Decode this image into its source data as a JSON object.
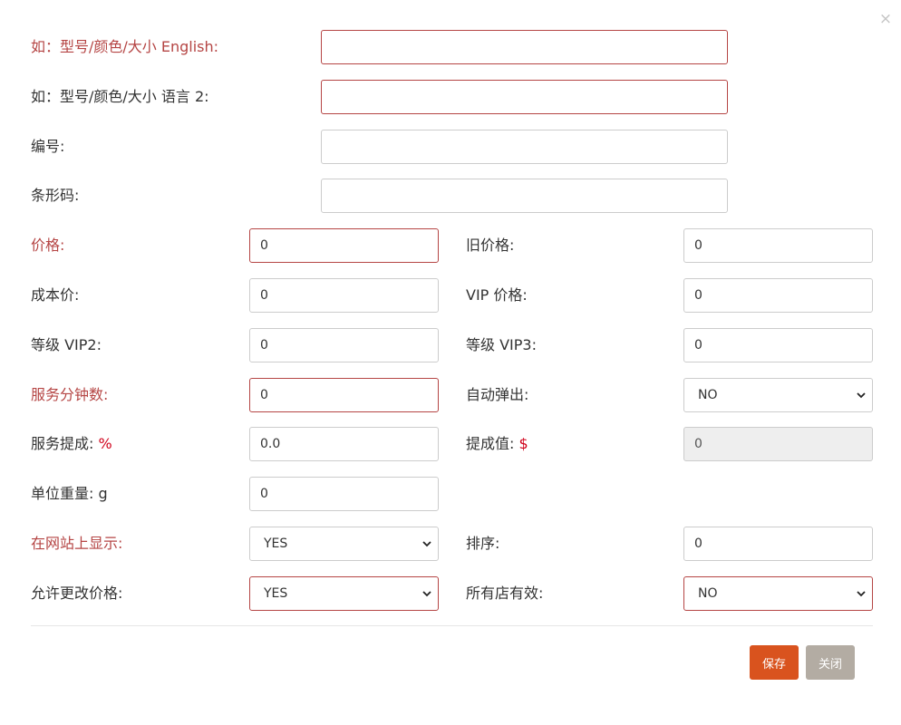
{
  "dialog": {
    "close_glyph": "×"
  },
  "fields": {
    "model_en": {
      "label": "如：型号/颜色/大小 English:",
      "value": ""
    },
    "model_lang2": {
      "label": "如：型号/颜色/大小 语言 2:",
      "value": ""
    },
    "code": {
      "label": "编号:",
      "value": ""
    },
    "barcode": {
      "label": "条形码:",
      "value": ""
    },
    "price": {
      "label": "价格:",
      "value": "0"
    },
    "old_price": {
      "label": "旧价格:",
      "value": "0"
    },
    "cost_price": {
      "label": "成本价:",
      "value": "0"
    },
    "vip_price": {
      "label": "VIP 价格:",
      "value": "0"
    },
    "level_vip2": {
      "label": "等级 VIP2:",
      "value": "0"
    },
    "level_vip3": {
      "label": "等级 VIP3:",
      "value": "0"
    },
    "service_minutes": {
      "label": "服务分钟数:",
      "value": "0"
    },
    "auto_popup": {
      "label": "自动弹出:",
      "value": "NO"
    },
    "service_commission": {
      "label": "服务提成:",
      "unit": "%",
      "value": "0.0"
    },
    "commission_value": {
      "label": "提成值:",
      "unit": "$",
      "value": "0"
    },
    "unit_weight": {
      "label": "单位重量: g",
      "value": "0"
    },
    "show_on_website": {
      "label": "在网站上显示:",
      "value": "YES"
    },
    "sort_order": {
      "label": "排序:",
      "value": "0"
    },
    "allow_price_change": {
      "label": "允许更改价格:",
      "value": "YES"
    },
    "all_stores_valid": {
      "label": "所有店有效:",
      "value": "NO"
    }
  },
  "footer": {
    "save_label": "保存",
    "close_label": "关闭"
  },
  "colors": {
    "required_label": "#b54544",
    "accent_symbol": "#d0021b",
    "save_button": "#d9531e",
    "close_button": "#b3aca3"
  }
}
